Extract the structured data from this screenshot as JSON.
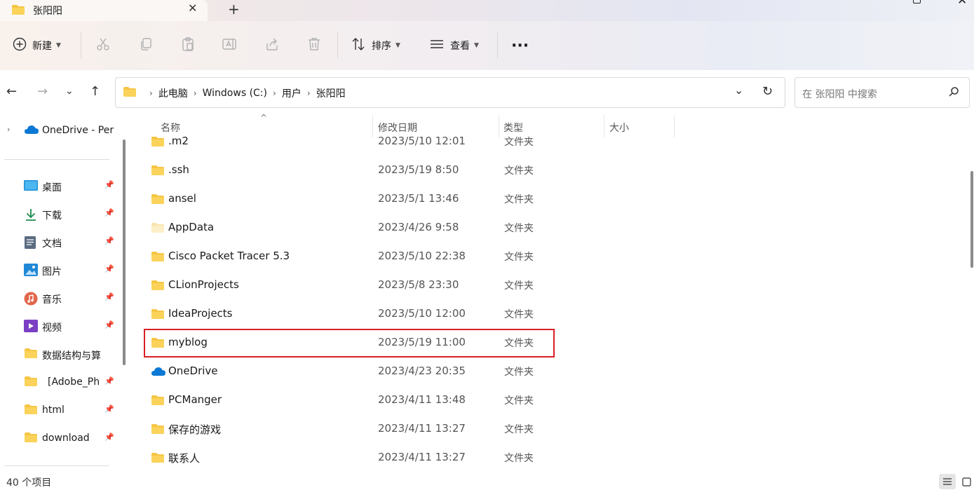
{
  "tab": {
    "title": "张阳阳",
    "close": "✕",
    "new": "+"
  },
  "toolbar": {
    "new_label": "新建",
    "sort_label": "排序",
    "view_label": "查看",
    "more": "···",
    "chevron": "⌄"
  },
  "address": {
    "crumbs": [
      "此电脑",
      "Windows (C:)",
      "用户",
      "张阳阳"
    ],
    "separator": "›",
    "search_placeholder": "在 张阳阳 中搜索"
  },
  "sidebar": {
    "onedrive": "OneDrive - Per",
    "items": [
      {
        "label": "桌面",
        "icon": "desktop-icon"
      },
      {
        "label": "下载",
        "icon": "download-icon"
      },
      {
        "label": "文档",
        "icon": "document-icon"
      },
      {
        "label": "图片",
        "icon": "picture-icon"
      },
      {
        "label": "音乐",
        "icon": "music-icon"
      },
      {
        "label": "视频",
        "icon": "video-icon"
      },
      {
        "label": "数据结构与算",
        "icon": "folder-icon"
      },
      {
        "label": "[Adobe_Ph",
        "icon": "folder-icon"
      },
      {
        "label": "html",
        "icon": "folder-icon"
      },
      {
        "label": "download",
        "icon": "folder-icon"
      }
    ]
  },
  "columns": {
    "name": "名称",
    "date": "修改日期",
    "type": "类型",
    "size": "大小"
  },
  "files": [
    {
      "name": ".m2",
      "date": "2023/5/10 12:01",
      "type": "文件夹",
      "icon": "folder"
    },
    {
      "name": ".ssh",
      "date": "2023/5/19 8:50",
      "type": "文件夹",
      "icon": "folder"
    },
    {
      "name": "ansel",
      "date": "2023/5/1 13:46",
      "type": "文件夹",
      "icon": "folder"
    },
    {
      "name": "AppData",
      "date": "2023/4/26 9:58",
      "type": "文件夹",
      "icon": "folder-hidden"
    },
    {
      "name": "Cisco Packet Tracer 5.3",
      "date": "2023/5/10 22:38",
      "type": "文件夹",
      "icon": "folder"
    },
    {
      "name": "CLionProjects",
      "date": "2023/5/8 23:30",
      "type": "文件夹",
      "icon": "folder"
    },
    {
      "name": "IdeaProjects",
      "date": "2023/5/10 12:00",
      "type": "文件夹",
      "icon": "folder"
    },
    {
      "name": "myblog",
      "date": "2023/5/19 11:00",
      "type": "文件夹",
      "icon": "folder"
    },
    {
      "name": "OneDrive",
      "date": "2023/4/23 20:35",
      "type": "文件夹",
      "icon": "cloud"
    },
    {
      "name": "PCManger",
      "date": "2023/4/11 13:48",
      "type": "文件夹",
      "icon": "folder"
    },
    {
      "name": "保存的游戏",
      "date": "2023/4/11 13:27",
      "type": "文件夹",
      "icon": "folder"
    },
    {
      "name": "联系人",
      "date": "2023/4/11 13:27",
      "type": "文件夹",
      "icon": "folder"
    }
  ],
  "status": {
    "count": "40 个项目"
  },
  "colors": {
    "folder": "#f6c544",
    "folder_dark": "#e8a82a",
    "highlight": "#d81f26",
    "accent": "#0067c0"
  }
}
